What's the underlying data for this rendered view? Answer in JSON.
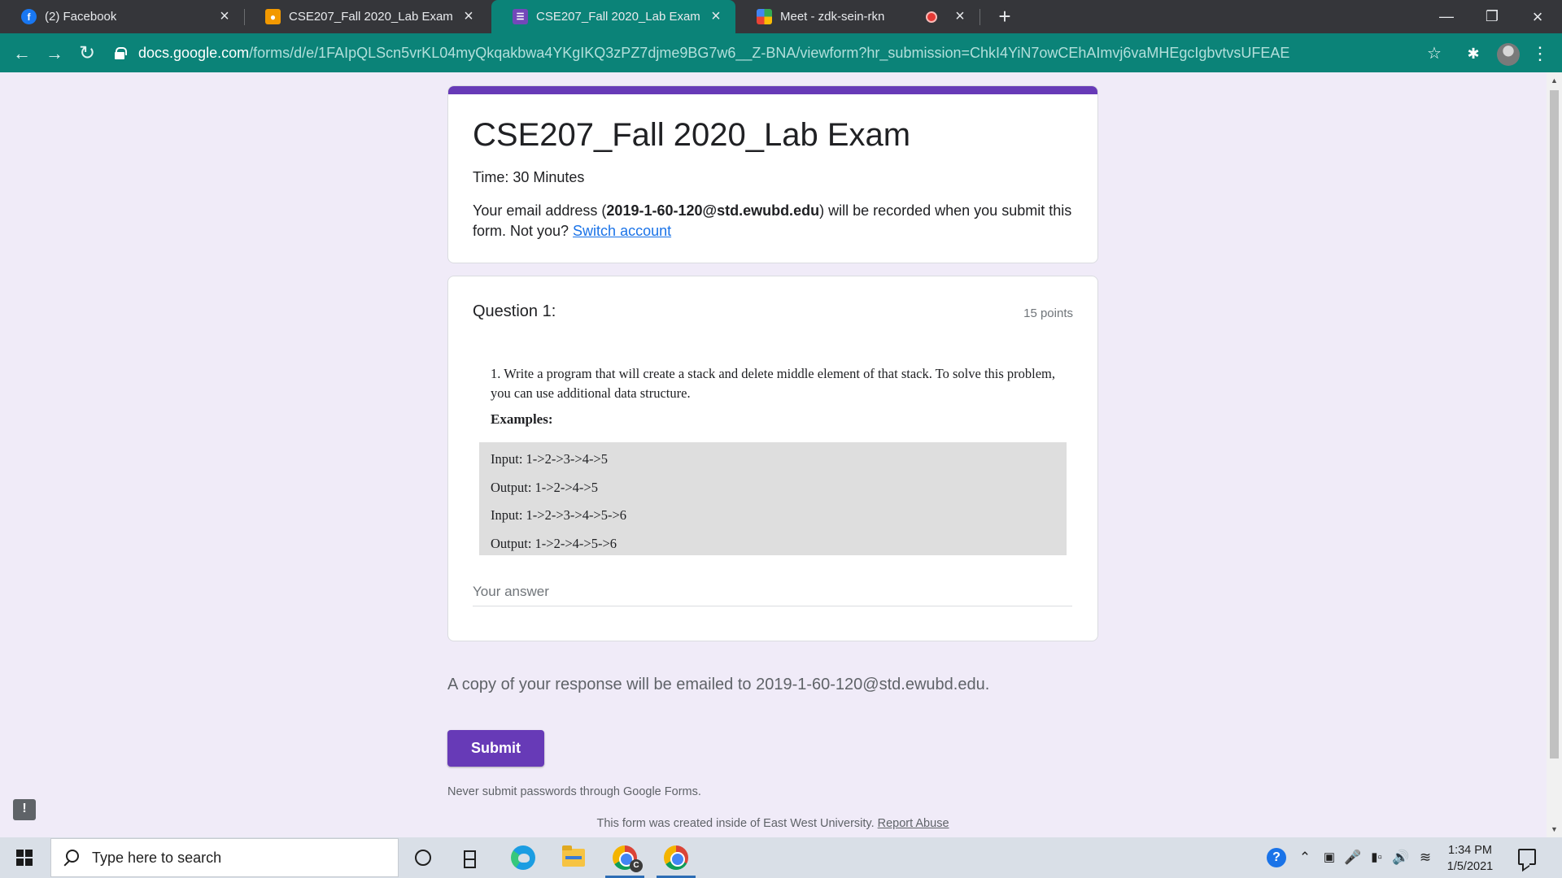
{
  "browser": {
    "tabs": [
      {
        "title": "(2) Facebook",
        "icon": "facebook-icon",
        "active": false
      },
      {
        "title": "CSE207_Fall 2020_Lab Exam",
        "icon": "google-classroom-icon",
        "active": false
      },
      {
        "title": "CSE207_Fall 2020_Lab Exam",
        "icon": "google-forms-icon",
        "active": true
      },
      {
        "title": "Meet - zdk-sein-rkn",
        "icon": "google-meet-icon",
        "active": false,
        "recording": true
      }
    ],
    "new_tab_label": "+",
    "url_host": "docs.google.com",
    "url_path": "/forms/d/e/1FAIpQLScn5vrKL04myQkqakbwa4YKgIKQ3zPZ7djme9BG7w6__Z-BNA/viewform?hr_submission=ChkI4YiN7owCEhAImvj6vaMHEgcIgbvtvsUFEAE",
    "colors": {
      "toolbar": "#0b8378",
      "tabstrip": "#35363a"
    }
  },
  "form": {
    "accent_color": "#673ab7",
    "title": "CSE207_Fall 2020_Lab Exam",
    "description": "Time: 30 Minutes",
    "email_prefix": "Your email address (",
    "email": "2019-1-60-120@std.ewubd.edu",
    "email_suffix": ") will be recorded when you submit this form. Not you? ",
    "switch_account": "Switch account"
  },
  "question": {
    "title": "Question 1:",
    "points": "15 points",
    "text": "1. Write a program that will create a stack and delete middle element of that stack. To solve this problem, you can use additional data structure.",
    "examples_label": "Examples:",
    "examples": [
      "Input: 1->2->3->4->5",
      "Output: 1->2->4->5",
      "Input: 1->2->3->4->5->6",
      "Output: 1->2->4->5->6"
    ],
    "answer_placeholder": "Your answer"
  },
  "footer": {
    "copy_notice": "A copy of your response will be emailed to 2019-1-60-120@std.ewubd.edu.",
    "submit_label": "Submit",
    "password_notice": "Never submit passwords through Google Forms.",
    "created_notice": "This form was created inside of East West University.",
    "report_abuse": "Report Abuse",
    "feedback_label": "!"
  },
  "taskbar": {
    "search_placeholder": "Type here to search",
    "chrome_badge": "C",
    "help_label": "?",
    "time": "1:34 PM",
    "date": "1/5/2021"
  }
}
